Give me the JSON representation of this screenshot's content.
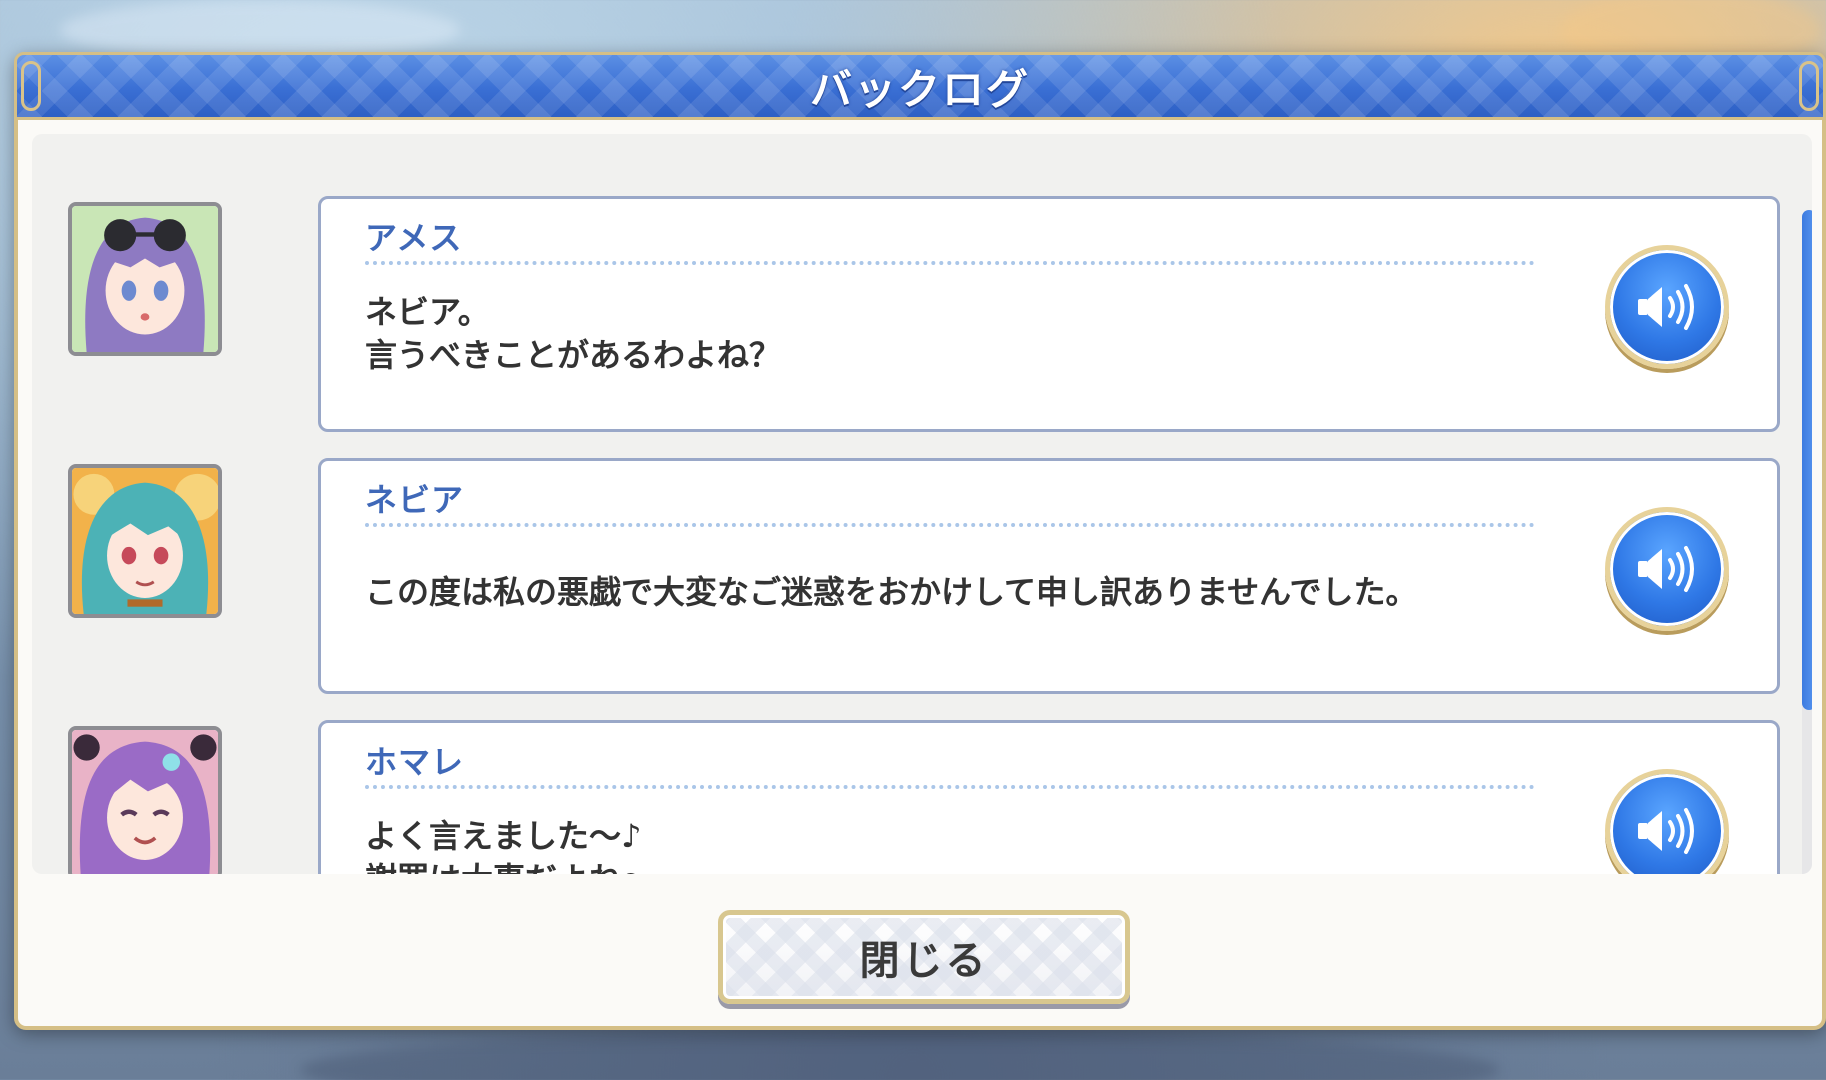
{
  "window": {
    "title": "バックログ"
  },
  "entries": [
    {
      "speaker": "アメス",
      "line1": "ネビア。",
      "line2": "言うべきことがあるわよね？",
      "portrait_icon": "ames-portrait",
      "voice_icon": "speaker-icon"
    },
    {
      "speaker": "ネビア",
      "line1": "この度は私の悪戯で大変なご迷惑をおかけして申し訳ありませんでした。",
      "line2": "",
      "portrait_icon": "nebia-portrait",
      "voice_icon": "speaker-icon"
    },
    {
      "speaker": "ホマレ",
      "line1": "よく言えました～♪",
      "line2": "謝罪は大事だよね～",
      "portrait_icon": "homare-portrait",
      "voice_icon": "speaker-icon"
    }
  ],
  "footer": {
    "close_label": "閉じる"
  },
  "colors": {
    "title_blue": "#3a6fd4",
    "speaker_blue": "#3f68b8",
    "gold_border": "#d5bf86",
    "voice_button_blue": "#2f78e6"
  }
}
